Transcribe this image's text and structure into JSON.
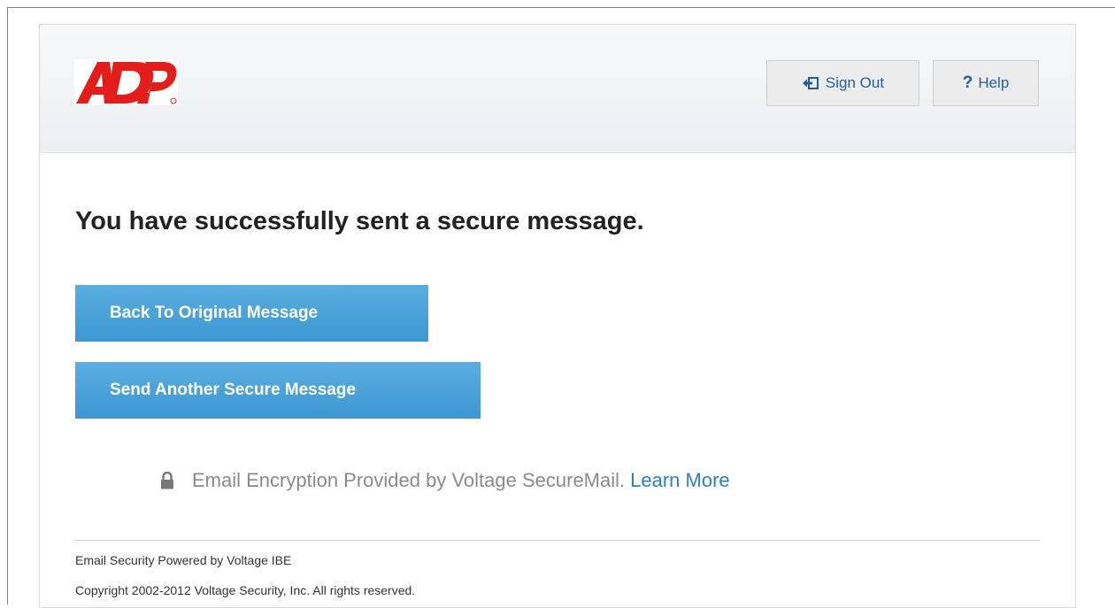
{
  "brand": {
    "logo_text": "ADP",
    "logo_color": "#e31d1a"
  },
  "header": {
    "signout_label": "Sign Out",
    "help_label": "Help",
    "help_glyph": "?",
    "signout_icon": "sign-out-icon"
  },
  "main": {
    "title": "You have successfully sent a secure message.",
    "back_button_label": "Back To Original Message",
    "send_button_label": "Send Another Secure Message",
    "button_color": "#4aa3db"
  },
  "encryption": {
    "icon": "lock-icon",
    "text": "Email Encryption Provided by Voltage SecureMail.",
    "link_label": "Learn More",
    "link_color": "#2e7fc1"
  },
  "footer": {
    "powered_by": "Email Security Powered by Voltage IBE",
    "copyright": "Copyright 2002-2012 Voltage Security, Inc. All rights reserved."
  }
}
